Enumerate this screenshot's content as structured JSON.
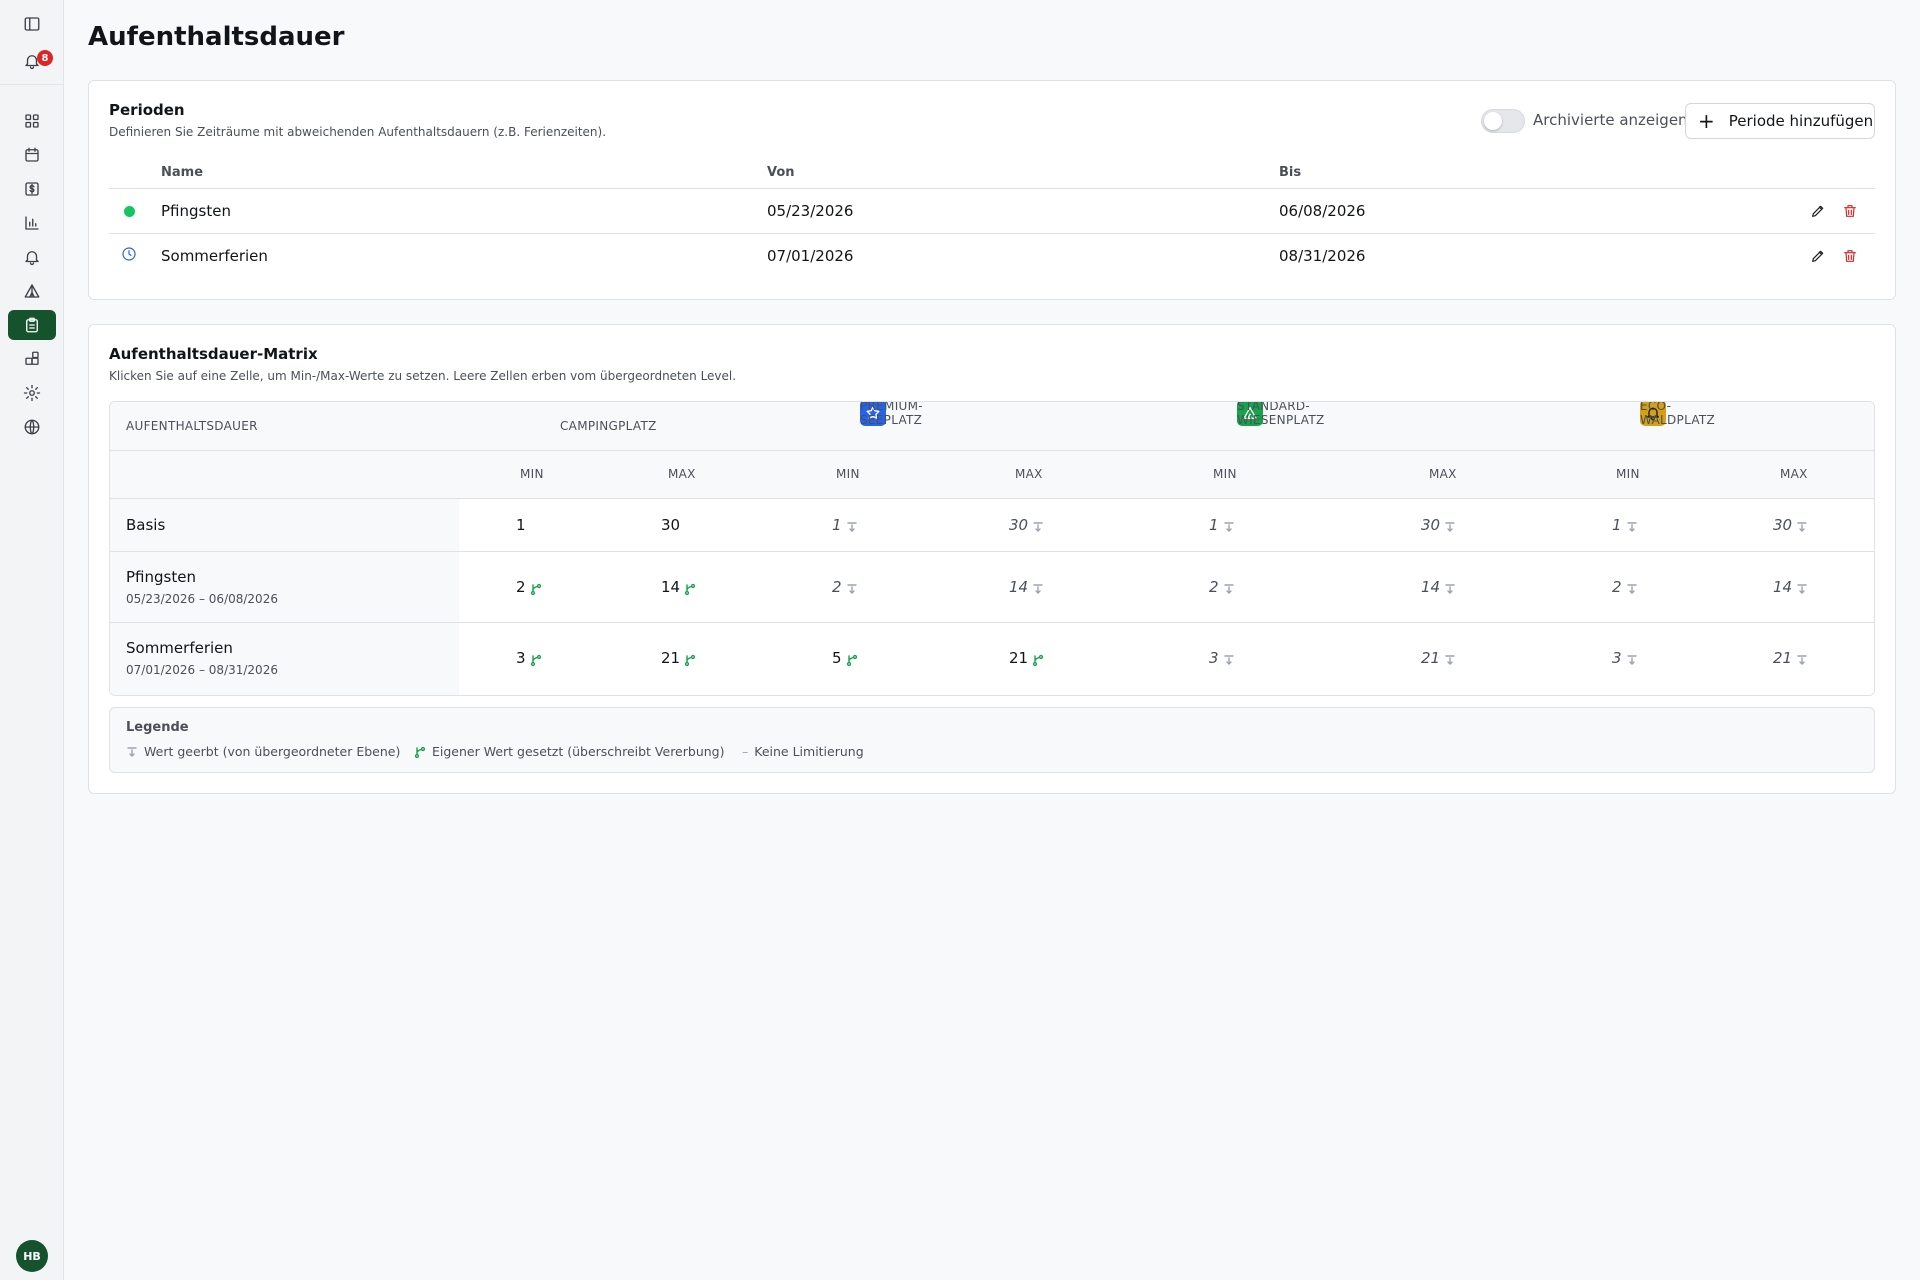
{
  "sidebar": {
    "notification_count": "8",
    "user_initials": "HB",
    "items": [
      {
        "icon": "panel-toggle-icon"
      },
      {
        "icon": "bell-icon"
      },
      {
        "icon": "dashboard-icon"
      },
      {
        "icon": "calendar-icon"
      },
      {
        "icon": "dollar-icon"
      },
      {
        "icon": "bar-chart-icon"
      },
      {
        "icon": "bell-icon"
      },
      {
        "icon": "tent-icon"
      },
      {
        "icon": "clipboard-icon",
        "active": true
      },
      {
        "icon": "apps-icon"
      },
      {
        "icon": "gear-icon"
      },
      {
        "icon": "globe-icon"
      }
    ]
  },
  "page": {
    "title": "Aufenthaltsdauer"
  },
  "periods": {
    "title": "Perioden",
    "subtitle": "Definieren Sie Zeiträume mit abweichenden Aufenthaltsdauern (z.B. Ferienzeiten).",
    "toggle_label": "Archivierte anzeigen",
    "toggle_on": false,
    "add_button": "Periode hinzufügen",
    "columns": {
      "name": "Name",
      "from": "Von",
      "to": "Bis"
    },
    "rows": [
      {
        "status": "active",
        "name": "Pfingsten",
        "from": "05/23/2026",
        "to": "06/08/2026"
      },
      {
        "status": "upcoming",
        "name": "Sommerferien",
        "from": "07/01/2026",
        "to": "08/31/2026"
      }
    ]
  },
  "matrix": {
    "title": "Aufenthaltsdauer-Matrix",
    "subtitle": "Klicken Sie auf eine Zelle, um Min-/Max-Werte zu setzen. Leere Zellen erben vom übergeordneten Level.",
    "row_header": "AUFENTHALTSDAUER",
    "min_label": "MIN",
    "max_label": "MAX",
    "places": [
      {
        "name": "CAMPINGPLATZ",
        "icon": null,
        "color": null
      },
      {
        "name": "PREMIUM-SEEPLATZ",
        "icon": "star-icon",
        "color": "#2563eb"
      },
      {
        "name": "STANDARD-WIESENPLATZ",
        "icon": "tent-icon",
        "color": "#16a34a"
      },
      {
        "name": "ECO-WALDPLATZ",
        "icon": "bell-icon",
        "color": "#d4a017"
      }
    ],
    "rows": [
      {
        "name": "Basis",
        "dates": "",
        "cells": [
          {
            "min": "1",
            "max": "30",
            "min_state": "own-plain",
            "max_state": "own-plain"
          },
          {
            "min": "1",
            "max": "30",
            "min_state": "inherited",
            "max_state": "inherited"
          },
          {
            "min": "1",
            "max": "30",
            "min_state": "inherited",
            "max_state": "inherited"
          },
          {
            "min": "1",
            "max": "30",
            "min_state": "inherited",
            "max_state": "inherited"
          }
        ]
      },
      {
        "name": "Pfingsten",
        "dates": "05/23/2026 – 06/08/2026",
        "cells": [
          {
            "min": "2",
            "max": "14",
            "min_state": "own",
            "max_state": "own"
          },
          {
            "min": "2",
            "max": "14",
            "min_state": "inherited",
            "max_state": "inherited"
          },
          {
            "min": "2",
            "max": "14",
            "min_state": "inherited",
            "max_state": "inherited"
          },
          {
            "min": "2",
            "max": "14",
            "min_state": "inherited",
            "max_state": "inherited"
          }
        ]
      },
      {
        "name": "Sommerferien",
        "dates": "07/01/2026 – 08/31/2026",
        "cells": [
          {
            "min": "3",
            "max": "21",
            "min_state": "own",
            "max_state": "own"
          },
          {
            "min": "5",
            "max": "21",
            "min_state": "own",
            "max_state": "own"
          },
          {
            "min": "3",
            "max": "21",
            "min_state": "inherited",
            "max_state": "inherited"
          },
          {
            "min": "3",
            "max": "21",
            "min_state": "inherited",
            "max_state": "inherited"
          }
        ]
      }
    ],
    "legend": {
      "title": "Legende",
      "inherited": "Wert geerbt (von übergeordneter Ebene)",
      "own": "Eigener Wert gesetzt (überschreibt Vererbung)",
      "none_symbol": "–",
      "none": "Keine Limitierung"
    }
  }
}
